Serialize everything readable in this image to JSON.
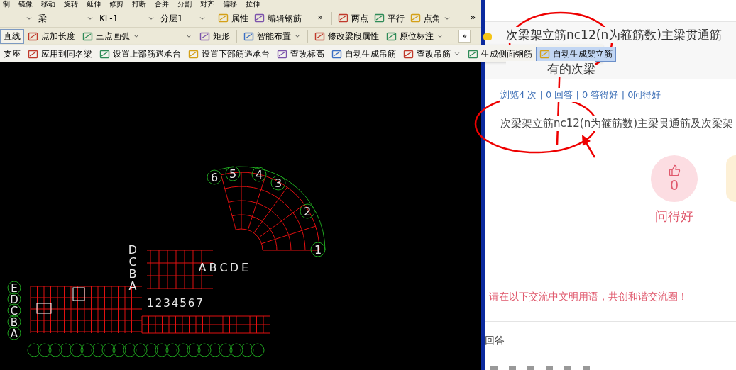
{
  "cad_toolbar": {
    "row_1": [
      "制",
      "镜像",
      "移动",
      "旋转",
      "延伸",
      "修剪",
      "打断",
      "合并",
      "分割",
      "对齐",
      "偏移",
      "拉伸"
    ],
    "row_2": {
      "selectors": [
        {
          "value": "梁"
        },
        {
          "value": "KL-1"
        },
        {
          "value": "分层1"
        }
      ],
      "buttons": [
        {
          "label": "属性"
        },
        {
          "label": "编辑钢筋"
        }
      ],
      "overflow": "»",
      "axis_buttons": [
        {
          "label": "两点",
          "dropdown": false
        },
        {
          "label": "平行",
          "dropdown": false
        },
        {
          "label": "点角",
          "dropdown": true
        }
      ],
      "overflow_end": "»"
    },
    "row_3": {
      "items": [
        {
          "kind": "button",
          "label": "直线",
          "pressed": true
        },
        {
          "kind": "button",
          "label": "点加长度",
          "pressed": false
        },
        {
          "kind": "dropdown",
          "label": "三点画弧",
          "pressed": false
        },
        {
          "kind": "select",
          "pressed": false
        },
        {
          "kind": "button",
          "label": "矩形",
          "pressed": false
        },
        {
          "kind": "dropdown",
          "label": "智能布置",
          "pressed": false
        },
        {
          "kind": "button",
          "label": "修改梁段属性",
          "pressed": false
        },
        {
          "kind": "dropdown",
          "label": "原位标注",
          "pressed": false
        }
      ],
      "overflow": "»"
    },
    "row_4": [
      {
        "label": "支座",
        "dropdown": false,
        "highlighted": false
      },
      {
        "label": "应用到同名梁",
        "dropdown": false,
        "highlighted": false
      },
      {
        "label": "设置上部筋遇承台",
        "dropdown": false,
        "highlighted": false
      },
      {
        "label": "设置下部筋遇承台",
        "dropdown": false,
        "highlighted": false
      },
      {
        "label": "查改标高",
        "dropdown": false,
        "highlighted": false
      },
      {
        "label": "自动生成吊筋",
        "dropdown": false,
        "highlighted": false
      },
      {
        "label": "查改吊筋",
        "dropdown": true,
        "highlighted": false
      },
      {
        "label": "生成侧面钢筋",
        "dropdown": false,
        "highlighted": false
      },
      {
        "label": "自动生成架立筋",
        "dropdown": false,
        "highlighted": true
      }
    ]
  },
  "cad_drawing": {
    "arc_axes": [
      "6",
      "5",
      "4",
      "3",
      "2",
      "1"
    ],
    "arc_row_axes": [
      "A",
      "B",
      "C",
      "D",
      "E"
    ],
    "upper_grid_rows": [
      "D",
      "C",
      "B",
      "A"
    ],
    "upper_grid_columns": [
      "1",
      "2",
      "3",
      "4",
      "5",
      "6",
      "7"
    ],
    "left_grid_rows": [
      "E",
      "D",
      "C",
      "B",
      "A"
    ]
  },
  "question": {
    "title_lines": [
      "次梁架立筋nc12(n为箍筋数)主梁贯通筋",
      "有的次梁"
    ],
    "stats": "浏览4 次 | 0 回答 | 0 答得好 | 0问得好",
    "body": "次梁架立筋nc12(n为箍筋数)主梁贯通筋及次梁架",
    "like_count": "0",
    "like_label": "问得好",
    "notice": "请在以下交流中文明用语，共创和谐交流圈！",
    "answers_heading": "回答"
  }
}
